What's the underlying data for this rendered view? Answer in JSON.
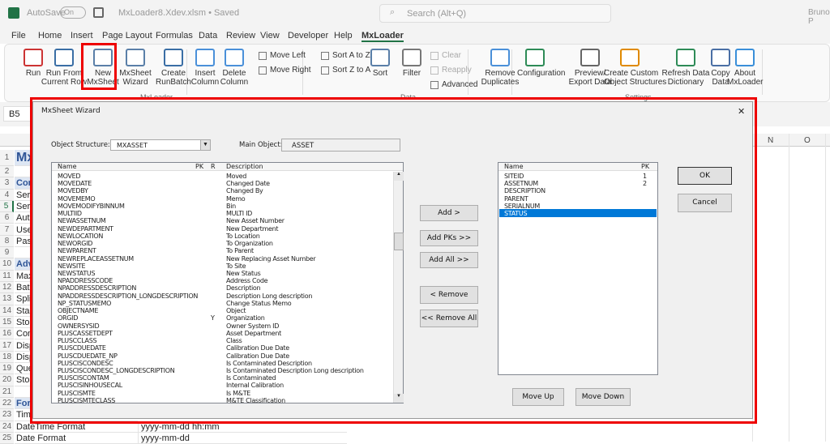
{
  "titlebar": {
    "autosave": "AutoSave",
    "toggle": "On",
    "filename": "MxLoader8.Xdev.xlsm • Saved",
    "search_placeholder": "Search (Alt+Q)",
    "user": "Bruno P"
  },
  "tabs": [
    "File",
    "Home",
    "Insert",
    "Page Layout",
    "Formulas",
    "Data",
    "Review",
    "View",
    "Developer",
    "Help",
    "MxLoader"
  ],
  "ribbon": {
    "buttons": [
      {
        "id": "run",
        "label": "Run"
      },
      {
        "id": "run-from-current-row",
        "label": "Run From\nCurrent Row"
      },
      {
        "id": "new-mxsheet",
        "label": "New\nMxSheet"
      },
      {
        "id": "mxsheet-wizard",
        "label": "MxSheet\nWizard"
      },
      {
        "id": "create-runbatch",
        "label": "Create\nRunBatch"
      },
      {
        "id": "insert-column",
        "label": "Insert\nColumn"
      },
      {
        "id": "delete-column",
        "label": "Delete\nColumn"
      },
      {
        "id": "sort",
        "label": "Sort"
      },
      {
        "id": "filter",
        "label": "Filter"
      },
      {
        "id": "remove-duplicates",
        "label": "Remove\nDuplicates"
      },
      {
        "id": "configuration",
        "label": "Configuration"
      },
      {
        "id": "preview-export",
        "label": "Preview/\nExport Data"
      },
      {
        "id": "create-custom-os",
        "label": "Create Custom\nObject Structures"
      },
      {
        "id": "refresh-dd",
        "label": "Refresh Data\nDictionary"
      },
      {
        "id": "copy-data",
        "label": "Copy\nData"
      },
      {
        "id": "about",
        "label": "About\nMxLoader"
      }
    ],
    "small": [
      {
        "id": "move-left",
        "label": "Move Left"
      },
      {
        "id": "move-right",
        "label": "Move Right"
      },
      {
        "id": "sort-a-z",
        "label": "Sort A to Z"
      },
      {
        "id": "sort-z-a",
        "label": "Sort Z to A"
      },
      {
        "id": "clear",
        "label": "Clear",
        "disabled": true
      },
      {
        "id": "reapply",
        "label": "Reapply",
        "disabled": true
      },
      {
        "id": "advanced",
        "label": "Advanced"
      }
    ],
    "groups": [
      {
        "label": "MxLoader"
      },
      {
        "label": "Data"
      },
      {
        "label": "Settings"
      }
    ]
  },
  "formula_bar": {
    "name_box": "B5"
  },
  "sheet": {
    "columns": [
      "N",
      "O"
    ],
    "selected_row": "5",
    "rows": [
      {
        "n": "1",
        "a": "MxL",
        "cls": "title"
      },
      {
        "n": "2",
        "a": ""
      },
      {
        "n": "3",
        "a": "Conn",
        "cls": "sec"
      },
      {
        "n": "4",
        "a": "Serve"
      },
      {
        "n": "5",
        "a": "Servi"
      },
      {
        "n": "6",
        "a": "Authe"
      },
      {
        "n": "7",
        "a": "User"
      },
      {
        "n": "8",
        "a": "Passw"
      },
      {
        "n": "9",
        "a": ""
      },
      {
        "n": "10",
        "a": "Adva",
        "cls": "sec"
      },
      {
        "n": "11",
        "a": "Maxi"
      },
      {
        "n": "12",
        "a": "Batch"
      },
      {
        "n": "13",
        "a": "Split"
      },
      {
        "n": "14",
        "a": "Star"
      },
      {
        "n": "15",
        "a": "Stop"
      },
      {
        "n": "16",
        "a": "Conti"
      },
      {
        "n": "17",
        "a": "Displ"
      },
      {
        "n": "18",
        "a": "Displ"
      },
      {
        "n": "19",
        "a": "Query"
      },
      {
        "n": "20",
        "a": "Store"
      },
      {
        "n": "21",
        "a": ""
      },
      {
        "n": "22",
        "a": "Forma",
        "cls": "sec"
      },
      {
        "n": "23",
        "a": "Timez"
      },
      {
        "n": "24",
        "a": "DateTime Format",
        "b": "yyyy-mm-dd hh:mm"
      },
      {
        "n": "25",
        "a": "Date Format",
        "b": "yyyy-mm-dd"
      }
    ]
  },
  "dialog": {
    "title": "MxSheet Wizard",
    "close": "✕",
    "object_structure_label": "Object Structure:",
    "object_structure_value": "MXASSET",
    "main_object_label": "Main Object:",
    "main_object_value": "ASSET",
    "available": {
      "headers": {
        "name": "Name",
        "pk": "PK",
        "r": "R",
        "description": "Description"
      },
      "items": [
        [
          "MOVED",
          "",
          "",
          "Moved"
        ],
        [
          "MOVEDATE",
          "",
          "",
          "Changed Date"
        ],
        [
          "MOVEDBY",
          "",
          "",
          "Changed By"
        ],
        [
          "MOVEMEMO",
          "",
          "",
          "Memo"
        ],
        [
          "MOVEMODIFYBINNUM",
          "",
          "",
          "Bin"
        ],
        [
          "MULTIID",
          "",
          "",
          "MULTI ID"
        ],
        [
          "NEWASSETNUM",
          "",
          "",
          "New Asset Number"
        ],
        [
          "NEWDEPARTMENT",
          "",
          "",
          "New Department"
        ],
        [
          "NEWLOCATION",
          "",
          "",
          "To Location"
        ],
        [
          "NEWORGID",
          "",
          "",
          "To Organization"
        ],
        [
          "NEWPARENT",
          "",
          "",
          "To Parent"
        ],
        [
          "NEWREPLACEASSETNUM",
          "",
          "",
          "New Replacing Asset Number"
        ],
        [
          "NEWSITE",
          "",
          "",
          "To Site"
        ],
        [
          "NEWSTATUS",
          "",
          "",
          "New Status"
        ],
        [
          "NPADDRESSCODE",
          "",
          "",
          "Address Code"
        ],
        [
          "NPADDRESSDESCRIPTION",
          "",
          "",
          "Description"
        ],
        [
          "NPADDRESSDESCRIPTION_LONGDESCRIPTION",
          "",
          "",
          "Description Long description"
        ],
        [
          "NP_STATUSMEMO",
          "",
          "",
          "Change Status Memo"
        ],
        [
          "OBJECTNAME",
          "",
          "",
          "Object"
        ],
        [
          "ORGID",
          "",
          "Y",
          "Organization"
        ],
        [
          "OWNERSYSID",
          "",
          "",
          "Owner System ID"
        ],
        [
          "PLUSCASSETDEPT",
          "",
          "",
          "Asset Department"
        ],
        [
          "PLUSCCLASS",
          "",
          "",
          "Class"
        ],
        [
          "PLUSCDUEDATE",
          "",
          "",
          "Calibration Due Date"
        ],
        [
          "PLUSCDUEDATE_NP",
          "",
          "",
          "Calibration Due Date"
        ],
        [
          "PLUSCISCONDESC",
          "",
          "",
          "Is Contaminated Description"
        ],
        [
          "PLUSCISCONDESC_LONGDESCRIPTION",
          "",
          "",
          "Is Contaminated Description Long description"
        ],
        [
          "PLUSCISCONTAM",
          "",
          "",
          "Is Contaminated"
        ],
        [
          "PLUSCISINHOUSECAL",
          "",
          "",
          "Internal Calibration"
        ],
        [
          "PLUSCISMTE",
          "",
          "",
          "Is M&TE"
        ],
        [
          "PLUSCISMTECLASS",
          "",
          "",
          "M&TE Classification"
        ]
      ]
    },
    "buttons": {
      "add": "Add >",
      "add_pks": "Add PKs >>",
      "add_all": "Add All >>",
      "remove": "< Remove",
      "remove_all": "<< Remove All",
      "ok": "OK",
      "cancel": "Cancel",
      "move_up": "Move Up",
      "move_down": "Move Down"
    },
    "selected": {
      "headers": {
        "name": "Name",
        "pk": "PK"
      },
      "selected_item": "STATUS",
      "items": [
        [
          "SITEID",
          "1"
        ],
        [
          "ASSETNUM",
          "2"
        ],
        [
          "DESCRIPTION",
          ""
        ],
        [
          "PARENT",
          ""
        ],
        [
          "SERIALNUM",
          ""
        ],
        [
          "STATUS",
          ""
        ]
      ]
    }
  },
  "colors": {
    "highlight": "#e00000",
    "selection": "#0078d7",
    "excel_green": "#217346"
  }
}
